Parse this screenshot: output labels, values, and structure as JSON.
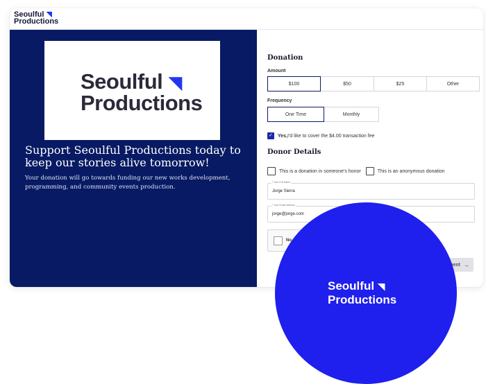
{
  "header": {
    "brand_line1": "Seoulful",
    "brand_line2": "Productions",
    "brand_mark": "◥"
  },
  "hero": {
    "logo_line1": "Seoulful",
    "logo_line2": "Productions",
    "logo_mark": "◥",
    "headline": "Support Seoulful Productions today to keep our stories alive tomorrow!",
    "body": "Your donation will go towards funding our new works development, programming, and community events production."
  },
  "donation": {
    "title": "Donation",
    "amount_label": "Amount",
    "amounts": [
      "$100",
      "$50",
      "$25",
      "Other"
    ],
    "selected_amount": "$100",
    "frequency_label": "Frequency",
    "frequencies": [
      "One Time",
      "Monthly"
    ],
    "selected_frequency": "One Time",
    "cover_fee_strong": "Yes,",
    "cover_fee_text": " I'd like to cover the $4.00 transaction fee",
    "cover_fee_checked": true
  },
  "donor": {
    "title": "Donor Details",
    "honor_label": "This is a donation in someone's honor",
    "anonymous_label": "This is an anonymous donation",
    "name_label": "* Your Full Name",
    "name_value": "Jorge Sierra",
    "email_label": "* Your Email Address",
    "email_value": "jorge@jorge.com",
    "captcha_text": "No soy u",
    "pay_button": "ment",
    "pay_arrow": "→"
  },
  "overlay": {
    "line1": "Seoulful",
    "line2": "Productions",
    "mark": "◥"
  },
  "colors": {
    "brand_blue": "#2236f0",
    "navy_panel": "#071a63",
    "overlay_blue": "#1f1fee"
  },
  "icons": {
    "brand_mark": "triangle-logo-icon",
    "checkbox_checked": "check-icon",
    "pay_arrow": "arrow-right-icon"
  }
}
